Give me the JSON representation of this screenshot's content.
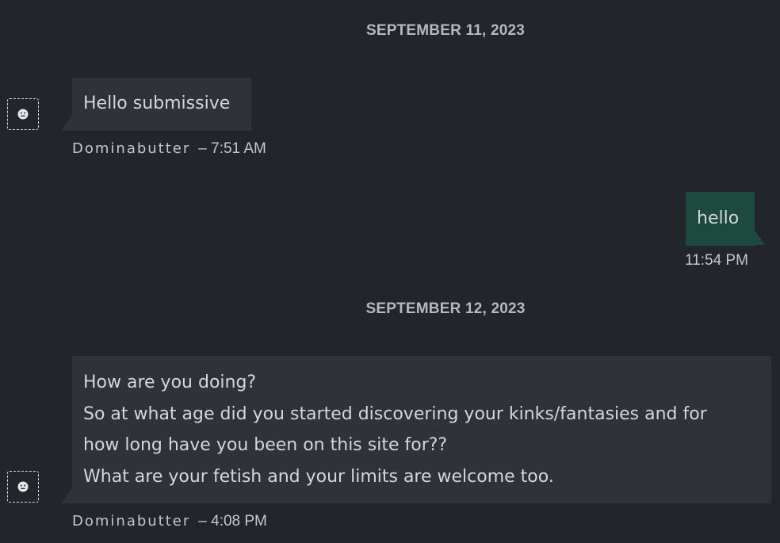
{
  "conversation": {
    "dates": [
      "SEPTEMBER 11, 2023",
      "SEPTEMBER 12, 2023"
    ],
    "messages": [
      {
        "direction": "incoming",
        "sender": "Dominabutter",
        "time_text": "– 7:51 AM",
        "lines": [
          "Hello submissive"
        ]
      },
      {
        "direction": "outgoing",
        "time_text": "11:54 PM",
        "lines": [
          "hello"
        ]
      },
      {
        "direction": "incoming",
        "sender": "Dominabutter",
        "time_text": "– 4:08 PM",
        "lines": [
          "How are you doing?",
          "So at what age did you started discovering your kinks/fantasies and for",
          "how long have you been on this site for??",
          "What are your fetish and your limits are welcome too."
        ]
      }
    ]
  },
  "colors": {
    "background": "#22262b",
    "incoming_bubble": "#2f3239",
    "outgoing_bubble": "#1d4a3f",
    "text": "#d3d6da"
  },
  "icons": {
    "avatar": "smiley-face-icon"
  }
}
